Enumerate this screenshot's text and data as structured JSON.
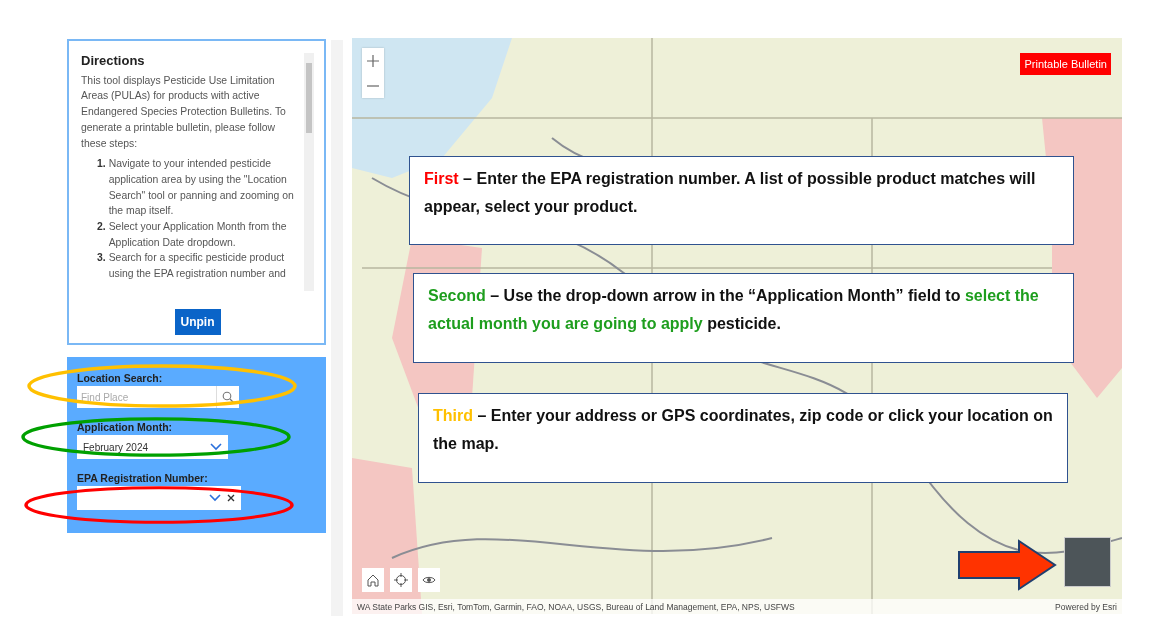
{
  "directions": {
    "title": "Directions",
    "intro": "This tool displays Pesticide Use Limitation Areas (PULAs) for products with active Endangered Species Protection Bulletins. To generate a printable bulletin, please follow these steps:",
    "steps": [
      {
        "number": "1.",
        "text": "Navigate to your intended pesticide application area by using the \"Location Search\" tool or panning and zooming on the map itself."
      },
      {
        "number": "2.",
        "text": "Select your Application Month from the Application Date dropdown."
      },
      {
        "number": "3.",
        "text": "Search for a specific pesticide product using the EPA registration number and"
      }
    ],
    "button": "Unpin"
  },
  "controls": [
    {
      "kind": "search",
      "label": "Location Search:",
      "placeholder": "Find Place"
    },
    {
      "kind": "select",
      "label": "Application Month:",
      "value": "February 2024",
      "clearable": false
    },
    {
      "kind": "select",
      "label": "EPA Registration Number:",
      "clearable": true
    }
  ],
  "map": {
    "print_button": "Printable Bulletin",
    "attribution": "WA State Parks GIS, Esri, TomTom, Garmin, FAO, NOAA, USGS, Bureau of Land Management, EPA, NPS, USFWS",
    "powered_by": "Powered by Esri"
  },
  "annotations": {
    "ellipses": [
      {
        "color": "#ffc000"
      },
      {
        "color": "#00a000"
      },
      {
        "color": "#ff0000"
      }
    ],
    "callouts": [
      {
        "segments": [
          {
            "text": "First",
            "color": "#ff0000"
          },
          {
            "text": " – Enter the EPA registration number. A list of possible product matches will appear, select your product."
          }
        ]
      },
      {
        "segments": [
          {
            "text": "Second",
            "color": "#1e9e1e"
          },
          {
            "text": " – Use the drop-down arrow in the “Application Month” field to "
          },
          {
            "text": "select the actual month you are going to apply",
            "color": "#1e9e1e"
          },
          {
            "text": " pesticide."
          }
        ]
      },
      {
        "segments": [
          {
            "text": "Third",
            "color": "#ffc000"
          },
          {
            "text": " – Enter your address or GPS coordinates, zip code or click your location on the map."
          }
        ]
      }
    ]
  }
}
